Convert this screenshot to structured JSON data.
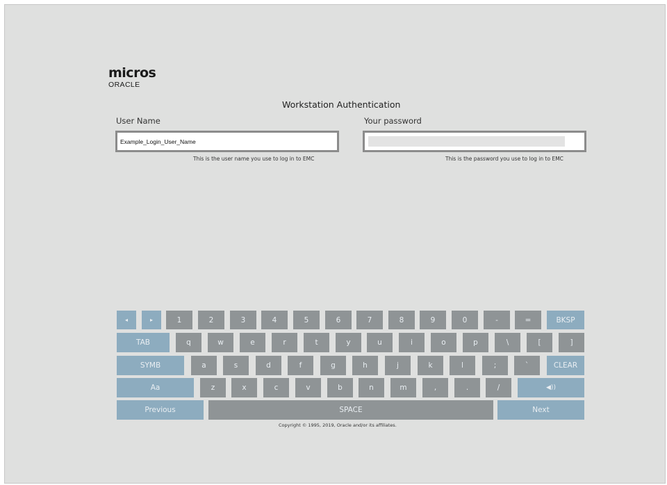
{
  "logo": {
    "brand": "micros",
    "sub": "ORACLE"
  },
  "title": "Workstation Authentication",
  "username": {
    "label": "User Name",
    "value": "Example_Login_User_Name",
    "hint": "This is the user name you use to log in to EMC"
  },
  "password": {
    "label": "Your password",
    "hint": "This is the password you use to log in to EMC"
  },
  "keyboard": {
    "row1": [
      "◂",
      "▸",
      "1",
      "2",
      "3",
      "4",
      "5",
      "6",
      "7",
      "8",
      "9",
      "0",
      "-",
      "=",
      "BKSP"
    ],
    "row2": [
      "TAB",
      "q",
      "w",
      "e",
      "r",
      "t",
      "y",
      "u",
      "i",
      "o",
      "p",
      "\\",
      "[",
      "]"
    ],
    "row3": [
      "SYMB",
      "a",
      "s",
      "d",
      "f",
      "g",
      "h",
      "j",
      "k",
      "l",
      ";",
      "`",
      "CLEAR"
    ],
    "row4": [
      "Aa",
      "z",
      "x",
      "c",
      "v",
      "b",
      "n",
      "m",
      ",",
      ".",
      "/",
      "◀))"
    ],
    "row5": [
      "Previous",
      "SPACE",
      "Next"
    ]
  },
  "copyright": "Copyright © 1995, 2019, Oracle and/or its affiliates."
}
